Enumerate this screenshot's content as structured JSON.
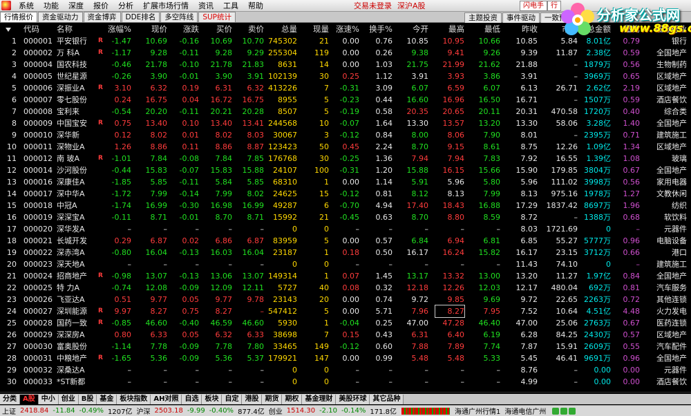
{
  "menu": {
    "items": [
      "系统",
      "功能",
      "深度",
      "报价",
      "分析",
      "扩展市场行情",
      "资讯",
      "工具",
      "帮助"
    ],
    "status_login": "交易未登录",
    "market": "深沪A股",
    "btn_flash": "闪电手",
    "btn_trade": "行"
  },
  "tabs": {
    "items": [
      "行情报价",
      "资金驱动力",
      "资金博弈",
      "DDE排名",
      "多空阵线",
      "SUP统计"
    ],
    "right_items": [
      "主题投资",
      "事件驱动",
      "一致预"
    ]
  },
  "logo": {
    "title": "分析家公式网",
    "url": "www.88gs.com"
  },
  "table": {
    "headers": [
      "代码",
      "名称",
      "涨幅%",
      "现价",
      "涨跌",
      "买价",
      "卖价",
      "总量",
      "现量",
      "涨速%",
      "换手%",
      "今开",
      "最高",
      "最低",
      "昨收",
      "市盈",
      "总金额",
      "量比",
      "细分行业"
    ],
    "rows": [
      {
        "n": "1",
        "code": "000001",
        "name": "平安银行",
        "flag": "R",
        "chg_pct": "-1.47",
        "price": "10.69",
        "chg": "-0.16",
        "bid": "10.69",
        "ask": "10.70",
        "vol": "745302",
        "cur_vol": "21",
        "speed": "0.00",
        "turnover": "0.76",
        "open": "10.85",
        "high": "10.95",
        "low": "10.66",
        "prev": "10.85",
        "pe": "5.84",
        "amount": "8.01亿",
        "ratio": "0.79",
        "industry": "银行"
      },
      {
        "n": "2",
        "code": "000002",
        "name": "万 科A",
        "flag": "R",
        "chg_pct": "-1.17",
        "price": "9.28",
        "chg": "-0.11",
        "bid": "9.28",
        "ask": "9.29",
        "vol": "255304",
        "cur_vol": "119",
        "speed": "0.00",
        "turnover": "0.26",
        "open": "9.38",
        "high": "9.41",
        "low": "9.26",
        "prev": "9.39",
        "pe": "11.87",
        "amount": "2.38亿",
        "ratio": "0.59",
        "industry": "全国地产"
      },
      {
        "n": "3",
        "code": "000004",
        "name": "国农科技",
        "flag": "",
        "chg_pct": "-0.46",
        "price": "21.78",
        "chg": "-0.10",
        "bid": "21.78",
        "ask": "21.83",
        "vol": "8631",
        "cur_vol": "14",
        "speed": "0.00",
        "turnover": "1.03",
        "open": "21.75",
        "high": "21.99",
        "low": "21.62",
        "prev": "21.88",
        "pe": "–",
        "amount": "1879万",
        "ratio": "0.56",
        "industry": "生物制药"
      },
      {
        "n": "4",
        "code": "000005",
        "name": "世纪星源",
        "flag": "",
        "chg_pct": "-0.26",
        "price": "3.90",
        "chg": "-0.01",
        "bid": "3.90",
        "ask": "3.91",
        "vol": "102139",
        "cur_vol": "30",
        "speed": "0.25",
        "turnover": "1.12",
        "open": "3.91",
        "high": "3.93",
        "low": "3.86",
        "prev": "3.91",
        "pe": "–",
        "amount": "3969万",
        "ratio": "0.65",
        "industry": "区域地产"
      },
      {
        "n": "5",
        "code": "000006",
        "name": "深振业A",
        "flag": "R",
        "chg_pct": "3.10",
        "price": "6.32",
        "chg": "0.19",
        "bid": "6.31",
        "ask": "6.32",
        "vol": "413226",
        "cur_vol": "7",
        "speed": "-0.31",
        "turnover": "3.09",
        "open": "6.07",
        "high": "6.59",
        "low": "6.07",
        "prev": "6.13",
        "pe": "26.71",
        "amount": "2.62亿",
        "ratio": "2.19",
        "industry": "区域地产"
      },
      {
        "n": "6",
        "code": "000007",
        "name": "零七股份",
        "flag": "",
        "chg_pct": "0.24",
        "price": "16.75",
        "chg": "0.04",
        "bid": "16.72",
        "ask": "16.75",
        "vol": "8955",
        "cur_vol": "5",
        "speed": "-0.23",
        "turnover": "0.44",
        "open": "16.60",
        "high": "16.96",
        "low": "16.50",
        "prev": "16.71",
        "pe": "–",
        "amount": "1507万",
        "ratio": "0.59",
        "industry": "酒店餐饮"
      },
      {
        "n": "7",
        "code": "000008",
        "name": "宝利来",
        "flag": "",
        "chg_pct": "-0.54",
        "price": "20.20",
        "chg": "-0.11",
        "bid": "20.21",
        "ask": "20.28",
        "vol": "8507",
        "cur_vol": "5",
        "speed": "-0.19",
        "turnover": "0.58",
        "open": "20.35",
        "high": "20.65",
        "low": "20.11",
        "prev": "20.31",
        "pe": "470.58",
        "amount": "1720万",
        "ratio": "0.40",
        "industry": "综合类"
      },
      {
        "n": "8",
        "code": "000009",
        "name": "中国宝安",
        "flag": "R",
        "chg_pct": "0.75",
        "price": "13.40",
        "chg": "0.10",
        "bid": "13.40",
        "ask": "13.41",
        "vol": "244568",
        "cur_vol": "10",
        "speed": "-0.07",
        "turnover": "1.64",
        "open": "13.30",
        "high": "13.57",
        "low": "13.20",
        "prev": "13.30",
        "pe": "58.06",
        "amount": "3.28亿",
        "ratio": "1.40",
        "industry": "全国地产"
      },
      {
        "n": "9",
        "code": "000010",
        "name": "深华新",
        "flag": "",
        "chg_pct": "0.12",
        "price": "8.02",
        "chg": "0.01",
        "bid": "8.02",
        "ask": "8.03",
        "vol": "30067",
        "cur_vol": "3",
        "speed": "-0.12",
        "turnover": "0.84",
        "open": "8.00",
        "high": "8.06",
        "low": "7.90",
        "prev": "8.01",
        "pe": "–",
        "amount": "2395万",
        "ratio": "0.71",
        "industry": "建筑施工"
      },
      {
        "n": "10",
        "code": "000011",
        "name": "深物业A",
        "flag": "",
        "chg_pct": "1.26",
        "price": "8.86",
        "chg": "0.11",
        "bid": "8.86",
        "ask": "8.87",
        "vol": "123423",
        "cur_vol": "50",
        "speed": "0.45",
        "turnover": "2.24",
        "open": "8.70",
        "high": "9.15",
        "low": "8.61",
        "prev": "8.75",
        "pe": "12.26",
        "amount": "1.09亿",
        "ratio": "1.34",
        "industry": "区域地产"
      },
      {
        "n": "11",
        "code": "000012",
        "name": "南 玻A",
        "flag": "R",
        "chg_pct": "-1.01",
        "price": "7.84",
        "chg": "-0.08",
        "bid": "7.84",
        "ask": "7.85",
        "vol": "176768",
        "cur_vol": "30",
        "speed": "-0.25",
        "turnover": "1.36",
        "open": "7.94",
        "high": "7.94",
        "low": "7.83",
        "prev": "7.92",
        "pe": "16.55",
        "amount": "1.39亿",
        "ratio": "1.08",
        "industry": "玻璃"
      },
      {
        "n": "12",
        "code": "000014",
        "name": "沙河股份",
        "flag": "",
        "chg_pct": "-0.44",
        "price": "15.83",
        "chg": "-0.07",
        "bid": "15.83",
        "ask": "15.88",
        "vol": "24107",
        "cur_vol": "100",
        "speed": "-0.31",
        "turnover": "1.20",
        "open": "15.88",
        "high": "16.15",
        "low": "15.66",
        "prev": "15.90",
        "pe": "179.85",
        "amount": "3804万",
        "ratio": "0.67",
        "industry": "全国地产"
      },
      {
        "n": "13",
        "code": "000016",
        "name": "深康佳A",
        "flag": "",
        "chg_pct": "-1.85",
        "price": "5.85",
        "chg": "-0.11",
        "bid": "5.84",
        "ask": "5.85",
        "vol": "68310",
        "cur_vol": "1",
        "speed": "0.00",
        "turnover": "1.14",
        "open": "5.91",
        "high": "5.96",
        "low": "5.80",
        "prev": "5.96",
        "pe": "111.02",
        "amount": "3998万",
        "ratio": "0.56",
        "industry": "家用电器"
      },
      {
        "n": "14",
        "code": "000017",
        "name": "深中华A",
        "flag": "",
        "chg_pct": "-1.72",
        "price": "7.99",
        "chg": "-0.14",
        "bid": "7.99",
        "ask": "8.02",
        "vol": "24625",
        "cur_vol": "15",
        "speed": "-0.12",
        "turnover": "0.81",
        "open": "8.12",
        "high": "8.13",
        "low": "7.99",
        "prev": "8.13",
        "pe": "975.16",
        "amount": "1978万",
        "ratio": "1.27",
        "industry": "文教休闲"
      },
      {
        "n": "15",
        "code": "000018",
        "name": "中冠A",
        "flag": "",
        "chg_pct": "-1.74",
        "price": "16.99",
        "chg": "-0.30",
        "bid": "16.98",
        "ask": "16.99",
        "vol": "49287",
        "cur_vol": "6",
        "speed": "-0.70",
        "turnover": "4.94",
        "open": "17.40",
        "high": "18.43",
        "low": "16.88",
        "prev": "17.29",
        "pe": "1837.42",
        "amount": "8697万",
        "ratio": "1.96",
        "industry": "纺织"
      },
      {
        "n": "16",
        "code": "000019",
        "name": "深深宝A",
        "flag": "",
        "chg_pct": "-0.11",
        "price": "8.71",
        "chg": "-0.01",
        "bid": "8.70",
        "ask": "8.71",
        "vol": "15992",
        "cur_vol": "21",
        "speed": "-0.45",
        "turnover": "0.63",
        "open": "8.70",
        "high": "8.80",
        "low": "8.59",
        "prev": "8.72",
        "pe": "–",
        "amount": "1388万",
        "ratio": "0.68",
        "industry": "软饮料"
      },
      {
        "n": "17",
        "code": "000020",
        "name": "深华发A",
        "flag": "",
        "chg_pct": "–",
        "price": "–",
        "chg": "–",
        "bid": "–",
        "ask": "–",
        "vol": "0",
        "cur_vol": "0",
        "speed": "–",
        "turnover": "–",
        "open": "–",
        "high": "–",
        "low": "–",
        "prev": "8.03",
        "pe": "1721.69",
        "amount": "0",
        "ratio": "–",
        "industry": "元器件"
      },
      {
        "n": "18",
        "code": "000021",
        "name": "长城开发",
        "flag": "",
        "chg_pct": "0.29",
        "price": "6.87",
        "chg": "0.02",
        "bid": "6.86",
        "ask": "6.87",
        "vol": "83959",
        "cur_vol": "5",
        "speed": "0.00",
        "turnover": "0.57",
        "open": "6.84",
        "high": "6.94",
        "low": "6.81",
        "prev": "6.85",
        "pe": "55.27",
        "amount": "5777万",
        "ratio": "0.96",
        "industry": "电脑设备"
      },
      {
        "n": "19",
        "code": "000022",
        "name": "深赤湾A",
        "flag": "",
        "chg_pct": "-0.80",
        "price": "16.04",
        "chg": "-0.13",
        "bid": "16.03",
        "ask": "16.04",
        "vol": "23187",
        "cur_vol": "1",
        "speed": "0.18",
        "turnover": "0.50",
        "open": "16.17",
        "high": "16.24",
        "low": "15.82",
        "prev": "16.17",
        "pe": "23.15",
        "amount": "3712万",
        "ratio": "0.66",
        "industry": "港口"
      },
      {
        "n": "20",
        "code": "000023",
        "name": "深天地A",
        "flag": "",
        "chg_pct": "–",
        "price": "–",
        "chg": "–",
        "bid": "–",
        "ask": "–",
        "vol": "0",
        "cur_vol": "0",
        "speed": "–",
        "turnover": "–",
        "open": "–",
        "high": "–",
        "low": "–",
        "prev": "11.43",
        "pe": "74.10",
        "amount": "0",
        "ratio": "–",
        "industry": "建筑施工"
      },
      {
        "n": "21",
        "code": "000024",
        "name": "招商地产",
        "flag": "R",
        "chg_pct": "-0.98",
        "price": "13.07",
        "chg": "-0.13",
        "bid": "13.06",
        "ask": "13.07",
        "vol": "149314",
        "cur_vol": "1",
        "speed": "0.07",
        "turnover": "1.45",
        "open": "13.17",
        "high": "13.32",
        "low": "13.00",
        "prev": "13.20",
        "pe": "11.27",
        "amount": "1.97亿",
        "ratio": "0.84",
        "industry": "全国地产"
      },
      {
        "n": "22",
        "code": "000025",
        "name": "特 力A",
        "flag": "",
        "chg_pct": "-0.74",
        "price": "12.08",
        "chg": "-0.09",
        "bid": "12.09",
        "ask": "12.11",
        "vol": "5727",
        "cur_vol": "40",
        "speed": "0.08",
        "turnover": "0.32",
        "open": "12.18",
        "high": "12.26",
        "low": "12.03",
        "prev": "12.17",
        "pe": "480.04",
        "amount": "692万",
        "ratio": "0.81",
        "industry": "汽车服务"
      },
      {
        "n": "23",
        "code": "000026",
        "name": "飞亚达A",
        "flag": "",
        "chg_pct": "0.51",
        "price": "9.77",
        "chg": "0.05",
        "bid": "9.77",
        "ask": "9.78",
        "vol": "23143",
        "cur_vol": "20",
        "speed": "0.00",
        "turnover": "0.74",
        "open": "9.72",
        "high": "9.85",
        "low": "9.69",
        "prev": "9.72",
        "pe": "22.65",
        "amount": "2263万",
        "ratio": "0.72",
        "industry": "其他连锁"
      },
      {
        "n": "24",
        "code": "000027",
        "name": "深圳能源",
        "flag": "R",
        "chg_pct": "9.97",
        "price": "8.27",
        "chg": "0.75",
        "bid": "8.27",
        "ask": "–",
        "vol": "547412",
        "cur_vol": "5",
        "speed": "0.00",
        "turnover": "5.71",
        "open": "7.96",
        "high": "8.27",
        "low": "7.95",
        "prev": "7.52",
        "pe": "10.64",
        "amount": "4.51亿",
        "ratio": "4.48",
        "industry": "火力发电"
      },
      {
        "n": "25",
        "code": "000028",
        "name": "国药一致",
        "flag": "R",
        "chg_pct": "-0.85",
        "price": "46.60",
        "chg": "-0.40",
        "bid": "46.59",
        "ask": "46.60",
        "vol": "5930",
        "cur_vol": "1",
        "speed": "-0.04",
        "turnover": "0.25",
        "open": "47.00",
        "high": "47.28",
        "low": "46.40",
        "prev": "47.00",
        "pe": "25.06",
        "amount": "2763万",
        "ratio": "0.67",
        "industry": "医药连锁"
      },
      {
        "n": "26",
        "code": "000029",
        "name": "深深房A",
        "flag": "",
        "chg_pct": "0.80",
        "price": "6.33",
        "chg": "0.05",
        "bid": "6.32",
        "ask": "6.33",
        "vol": "38698",
        "cur_vol": "7",
        "speed": "0.15",
        "turnover": "0.43",
        "open": "6.31",
        "high": "6.40",
        "low": "6.19",
        "prev": "6.28",
        "pe": "84.25",
        "amount": "2430万",
        "ratio": "0.57",
        "industry": "区域地产"
      },
      {
        "n": "27",
        "code": "000030",
        "name": "富奥股份",
        "flag": "",
        "chg_pct": "-1.14",
        "price": "7.78",
        "chg": "-0.09",
        "bid": "7.78",
        "ask": "7.80",
        "vol": "33465",
        "cur_vol": "149",
        "speed": "-0.12",
        "turnover": "0.60",
        "open": "7.88",
        "high": "7.89",
        "low": "7.74",
        "prev": "7.87",
        "pe": "15.91",
        "amount": "2609万",
        "ratio": "0.55",
        "industry": "汽车配件"
      },
      {
        "n": "28",
        "code": "000031",
        "name": "中粮地产",
        "flag": "R",
        "chg_pct": "-1.65",
        "price": "5.36",
        "chg": "-0.09",
        "bid": "5.36",
        "ask": "5.37",
        "vol": "179921",
        "cur_vol": "147",
        "speed": "0.00",
        "turnover": "0.99",
        "open": "5.48",
        "high": "5.48",
        "low": "5.33",
        "prev": "5.45",
        "pe": "46.41",
        "amount": "9691万",
        "ratio": "0.96",
        "industry": "全国地产"
      },
      {
        "n": "29",
        "code": "000032",
        "name": "深桑达A",
        "flag": "",
        "chg_pct": "–",
        "price": "–",
        "chg": "–",
        "bid": "–",
        "ask": "–",
        "vol": "0",
        "cur_vol": "0",
        "speed": "–",
        "turnover": "–",
        "open": "–",
        "high": "–",
        "low": "–",
        "prev": "8.76",
        "pe": "–",
        "amount": "0.00",
        "ratio": "0.00",
        "industry": "元器件"
      },
      {
        "n": "30",
        "code": "000033",
        "name": "*ST新都",
        "flag": "",
        "chg_pct": "–",
        "price": "–",
        "chg": "–",
        "bid": "–",
        "ask": "–",
        "vol": "0",
        "cur_vol": "0",
        "speed": "–",
        "turnover": "–",
        "open": "–",
        "high": "–",
        "low": "–",
        "prev": "4.99",
        "pe": "–",
        "amount": "0.00",
        "ratio": "0.00",
        "industry": "酒店餐饮"
      }
    ]
  },
  "bottom_tabs": [
    "分类",
    "A股",
    "中小",
    "创业",
    "B股",
    "基金",
    "板块指数",
    "AH对照",
    "自选",
    "板块",
    "自定",
    "港股",
    "期货",
    "期权",
    "基金理财",
    "美股环球",
    "其它品种"
  ],
  "bottom_active": "A股",
  "status": {
    "sh_label": "上证",
    "sh_index": "2418.84",
    "sh_chg": "-11.84",
    "sh_pct": "-0.49%",
    "sh_amt": "1207亿",
    "sz_label": "沪深",
    "sz_index": "2503.18",
    "sz_chg": "-9.99",
    "sz_pct": "-0.40%",
    "sz_amt": "877.4亿",
    "cy_label": "创业",
    "cy_index": "1514.30",
    "cy_chg": "-2.10",
    "cy_pct": "-0.14%",
    "cy_amt": "171.8亿",
    "server": "海通广州行情1",
    "server2": "海通电信广州"
  },
  "colors": {
    "up": "#ff3c3c",
    "down": "#20e020",
    "volume": "#ffd800",
    "amount": "#00e8e8",
    "industry": "#e8e8e8"
  }
}
